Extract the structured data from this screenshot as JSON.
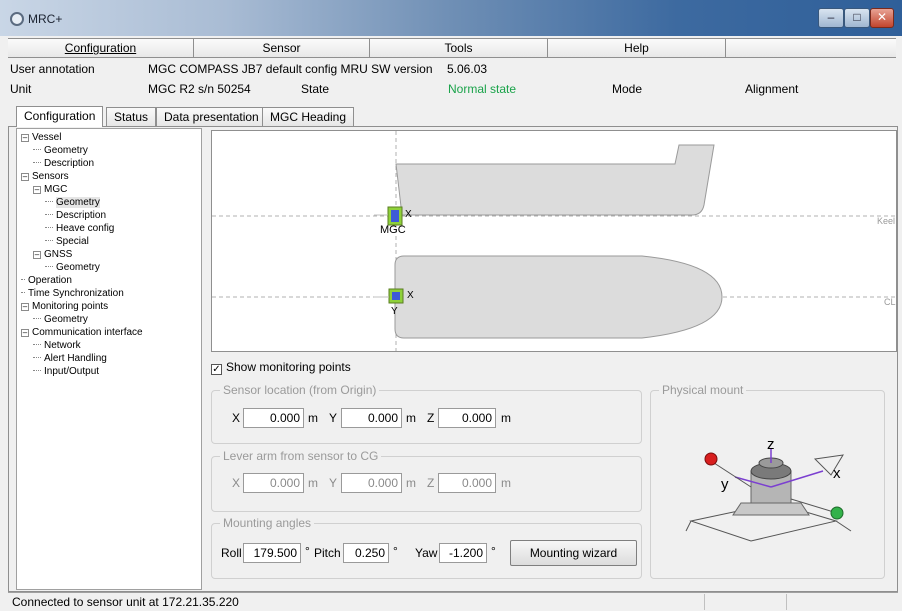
{
  "window": {
    "title": "MRC+"
  },
  "menu": [
    {
      "label": "Configuration"
    },
    {
      "label": "Sensor"
    },
    {
      "label": "Tools"
    },
    {
      "label": "Help"
    },
    {
      "label": ""
    }
  ],
  "info": {
    "user_annotation_label": "User annotation",
    "user_annotation_value": "MGC COMPASS JB7 default config MRU SW version",
    "sw_version": "5.06.03",
    "unit_label": "Unit",
    "unit_value": "MGC R2  s/n 50254",
    "state_label": "State",
    "state_value": "Normal state",
    "mode_label": "Mode",
    "alignment_label": "Alignment"
  },
  "tabs": [
    {
      "label": "Configuration",
      "active": true
    },
    {
      "label": "Status",
      "active": false
    },
    {
      "label": "Data presentation",
      "active": false
    },
    {
      "label": "MGC Heading",
      "active": false
    }
  ],
  "tree": [
    {
      "label": "Vessel",
      "type": "expanded",
      "level": 0
    },
    {
      "label": "Geometry",
      "type": "leaf",
      "level": 1
    },
    {
      "label": "Description",
      "type": "leaf",
      "level": 1
    },
    {
      "label": "Sensors",
      "type": "expanded",
      "level": 0
    },
    {
      "label": "MGC",
      "type": "expanded",
      "level": 1
    },
    {
      "label": "Geometry",
      "type": "leaf",
      "level": 2,
      "selected": true
    },
    {
      "label": "Description",
      "type": "leaf",
      "level": 2
    },
    {
      "label": "Heave config",
      "type": "leaf",
      "level": 2
    },
    {
      "label": "Special",
      "type": "leaf",
      "level": 2
    },
    {
      "label": "GNSS",
      "type": "expanded",
      "level": 1
    },
    {
      "label": "Geometry",
      "type": "leaf",
      "level": 2
    },
    {
      "label": "Operation",
      "type": "leaf",
      "level": 0
    },
    {
      "label": "Time Synchronization",
      "type": "leaf",
      "level": 0
    },
    {
      "label": "Monitoring points",
      "type": "expanded",
      "level": 0
    },
    {
      "label": "Geometry",
      "type": "leaf",
      "level": 1
    },
    {
      "label": "Communication interface",
      "type": "expanded",
      "level": 0
    },
    {
      "label": "Network",
      "type": "leaf",
      "level": 1
    },
    {
      "label": "Alert Handling",
      "type": "leaf",
      "level": 1
    },
    {
      "label": "Input/Output",
      "type": "leaf",
      "level": 1
    }
  ],
  "canvas": {
    "sensor_label": "MGC",
    "keel_label": "Keel",
    "cl_label": "CL",
    "axis_x": "X",
    "axis_y": "Y"
  },
  "show_monitoring_points": {
    "label": "Show monitoring points",
    "checked": true
  },
  "sensor_location": {
    "title": "Sensor location (from Origin)",
    "x_label": "X",
    "x_value": "0.000",
    "y_label": "Y",
    "y_value": "0.000",
    "z_label": "Z",
    "z_value": "0.000",
    "unit": "m"
  },
  "lever_arm": {
    "title": "Lever arm from sensor to CG",
    "x_label": "X",
    "x_value": "0.000",
    "y_label": "Y",
    "y_value": "0.000",
    "z_label": "Z",
    "z_value": "0.000",
    "unit": "m"
  },
  "mounting_angles": {
    "title": "Mounting angles",
    "roll_label": "Roll",
    "roll_value": "179.500",
    "pitch_label": "Pitch",
    "pitch_value": "0.250",
    "yaw_label": "Yaw",
    "yaw_value": "-1.200",
    "unit": "°",
    "wizard_label": "Mounting wizard"
  },
  "physical_mount": {
    "title": "Physical mount",
    "axis_x": "x",
    "axis_y": "y",
    "axis_z": "z"
  },
  "status": {
    "text": "Connected to sensor unit at 172.21.35.220"
  },
  "colors": {
    "state_ok": "#1aa34a",
    "sensor_blue": "#3d5bd8",
    "sensor_green": "#8fd13a"
  }
}
